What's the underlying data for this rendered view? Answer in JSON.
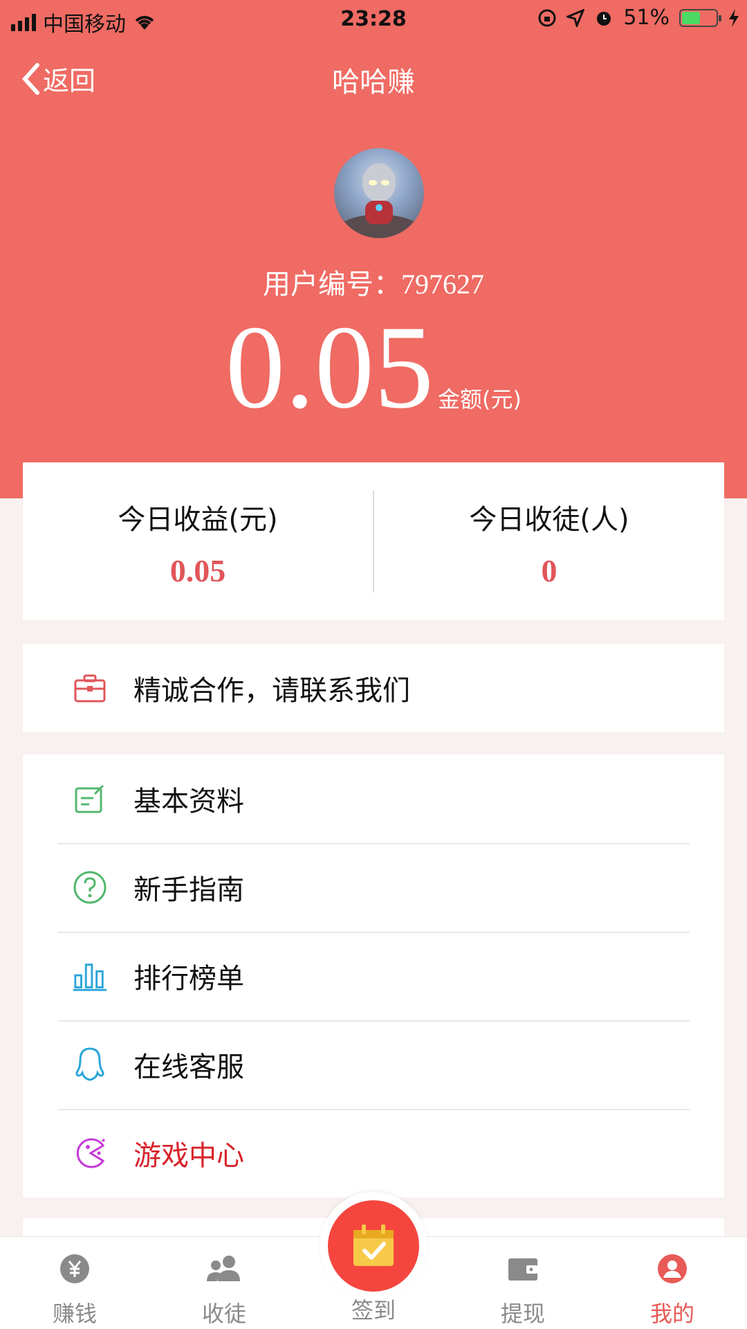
{
  "status_bar": {
    "carrier": "中国移动",
    "time": "23:28",
    "battery": "51%"
  },
  "nav": {
    "back_label": "返回",
    "title": "哈哈赚"
  },
  "profile": {
    "user_id_label": "用户编号：",
    "user_id": "797627",
    "balance": "0.05",
    "balance_unit": "金额(元)"
  },
  "stats": [
    {
      "label": "今日收益(元)",
      "value": "0.05"
    },
    {
      "label": "今日收徒(人)",
      "value": "0"
    }
  ],
  "cooperation": {
    "label": "精诚合作，请联系我们",
    "icon": "briefcase-icon"
  },
  "menu": [
    {
      "label": "基本资料",
      "icon": "edit-icon"
    },
    {
      "label": "新手指南",
      "icon": "question-icon"
    },
    {
      "label": "排行榜单",
      "icon": "chart-icon"
    },
    {
      "label": "在线客服",
      "icon": "qq-icon"
    },
    {
      "label": "游戏中心",
      "icon": "game-icon"
    }
  ],
  "tabs": [
    {
      "label": "赚钱",
      "icon": "yen-icon"
    },
    {
      "label": "收徒",
      "icon": "users-icon"
    },
    {
      "label": "签到",
      "icon": "calendar-check-icon"
    },
    {
      "label": "提现",
      "icon": "wallet-icon"
    },
    {
      "label": "我的",
      "icon": "user-icon"
    }
  ],
  "colors": {
    "brand": "#ef6b63",
    "value_red": "#e0565a",
    "alert_red": "#d8222a",
    "active_tab": "#e85a55"
  }
}
